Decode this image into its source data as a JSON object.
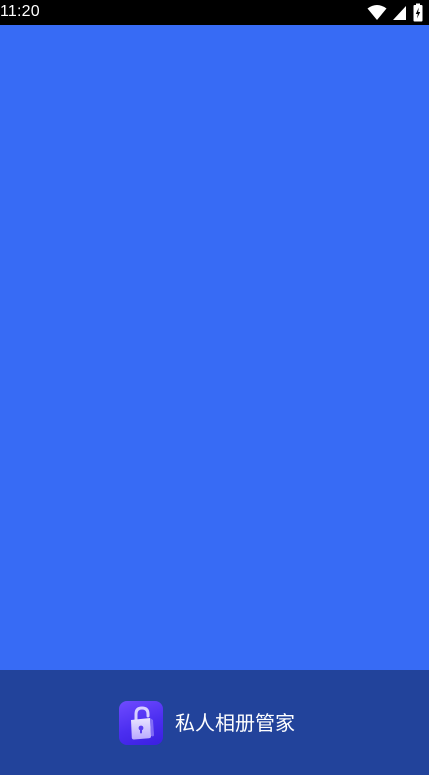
{
  "status_bar": {
    "time": "11:20",
    "icons": [
      "wifi-icon",
      "cellular-signal-icon",
      "battery-charging-icon"
    ]
  },
  "brand": {
    "app_name": "私人相册管家",
    "icon": "lock-icon"
  },
  "colors": {
    "splash_background": "#376bf5",
    "bottom_bar_background": "#22439b",
    "status_bar_background": "#000000",
    "icon_gradient_start": "#6f4bff",
    "icon_gradient_end": "#3a1fe0"
  }
}
